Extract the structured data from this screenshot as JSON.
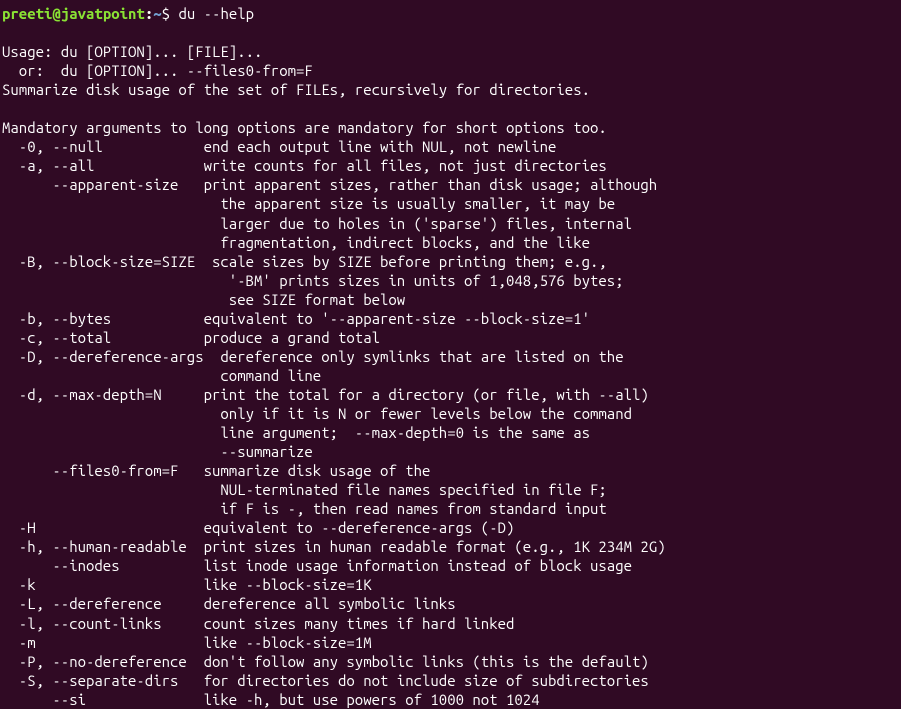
{
  "prompt": {
    "user": "preeti",
    "at": "@",
    "host": "javatpoint",
    "colon": ":",
    "path": "~",
    "dollar": "$ ",
    "command": "du --help"
  },
  "lines": {
    "l1": "Usage: du [OPTION]... [FILE]...",
    "l2": "  or:  du [OPTION]... --files0-from=F",
    "l3": "Summarize disk usage of the set of FILEs, recursively for directories.",
    "l4": "",
    "l5": "Mandatory arguments to long options are mandatory for short options too.",
    "l6": "  -0, --null            end each output line with NUL, not newline",
    "l7": "  -a, --all             write counts for all files, not just directories",
    "l8": "      --apparent-size   print apparent sizes, rather than disk usage; although",
    "l9": "                          the apparent size is usually smaller, it may be",
    "l10": "                          larger due to holes in ('sparse') files, internal",
    "l11": "                          fragmentation, indirect blocks, and the like",
    "l12": "  -B, --block-size=SIZE  scale sizes by SIZE before printing them; e.g.,",
    "l13": "                           '-BM' prints sizes in units of 1,048,576 bytes;",
    "l14": "                           see SIZE format below",
    "l15": "  -b, --bytes           equivalent to '--apparent-size --block-size=1'",
    "l16": "  -c, --total           produce a grand total",
    "l17": "  -D, --dereference-args  dereference only symlinks that are listed on the",
    "l18": "                          command line",
    "l19": "  -d, --max-depth=N     print the total for a directory (or file, with --all)",
    "l20": "                          only if it is N or fewer levels below the command",
    "l21": "                          line argument;  --max-depth=0 is the same as",
    "l22": "                          --summarize",
    "l23": "      --files0-from=F   summarize disk usage of the",
    "l24": "                          NUL-terminated file names specified in file F;",
    "l25": "                          if F is -, then read names from standard input",
    "l26": "  -H                    equivalent to --dereference-args (-D)",
    "l27": "  -h, --human-readable  print sizes in human readable format (e.g., 1K 234M 2G)",
    "l28": "      --inodes          list inode usage information instead of block usage",
    "l29": "  -k                    like --block-size=1K",
    "l30": "  -L, --dereference     dereference all symbolic links",
    "l31": "  -l, --count-links     count sizes many times if hard linked",
    "l32": "  -m                    like --block-size=1M",
    "l33": "  -P, --no-dereference  don't follow any symbolic links (this is the default)",
    "l34": "  -S, --separate-dirs   for directories do not include size of subdirectories",
    "l35": "      --si              like -h, but use powers of 1000 not 1024"
  }
}
